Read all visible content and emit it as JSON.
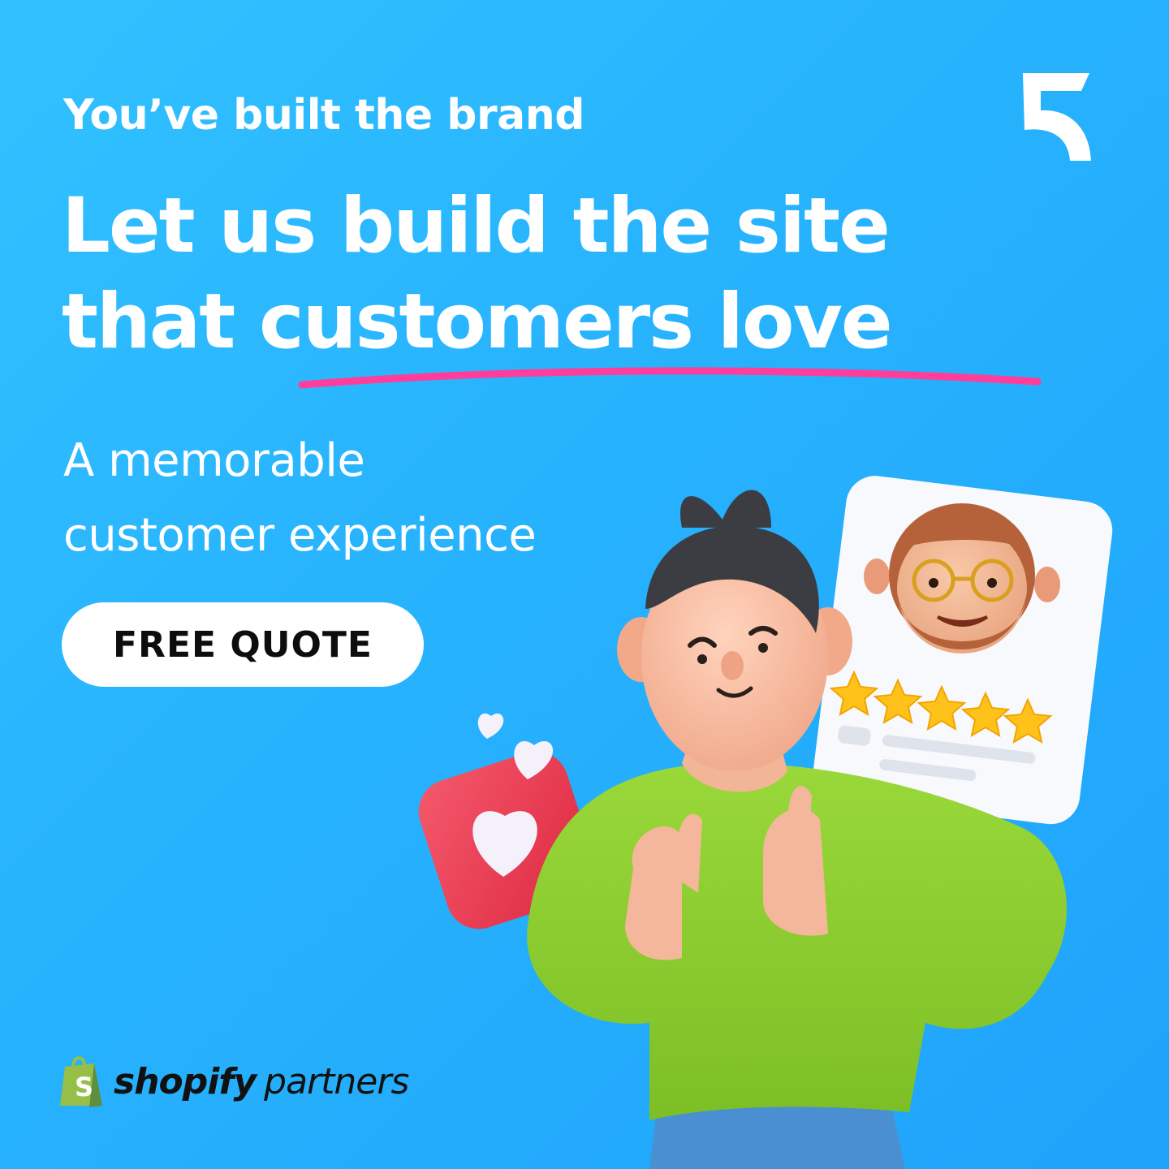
{
  "eyebrow": "You’ve built the brand",
  "headline": {
    "line1": "Let us build the site",
    "line2_start": "that ",
    "line2_emphasis": "customers love"
  },
  "subline": {
    "line1": "A memorable",
    "line2": "customer experience"
  },
  "cta": {
    "label": "FREE QUOTE"
  },
  "partner": {
    "brand": "shopify",
    "label": "partners"
  },
  "review_card": {
    "rating": 5,
    "max_rating": 5
  },
  "icons": [
    "brand-logo-icon",
    "shopify-bag-icon",
    "heart-notification-icon",
    "reviewer-avatar-icon",
    "star-icon"
  ],
  "colors": {
    "background": "#27b2fd",
    "text": "#ffffff",
    "underline": "#ff3d9a",
    "button_bg": "#ffffff",
    "button_text": "#0d0d0d",
    "shopify_green": "#95bf47",
    "sweater": "#8ccf2e",
    "heart_badge": "#ee3b53",
    "star": "#ffc21a"
  }
}
